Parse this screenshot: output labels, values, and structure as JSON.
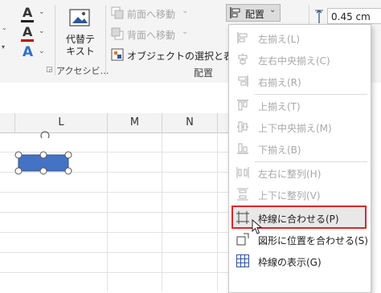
{
  "ribbon": {
    "font_group": {
      "font_color_glyph": "A",
      "highlight_glyph": "A",
      "text_effects_glyph": "A"
    },
    "alt_text_button_label": "代替テ\nキスト",
    "accessibility_group_label": "アクセシビ…",
    "arrange": {
      "bring_forward": "前面へ移動",
      "send_backward": "背面へ移動",
      "selection_pane": "オブジェクトの選択と表示",
      "group_label": "配置",
      "align_button_label": "配置"
    },
    "size": {
      "height_value": "0.45 cm"
    }
  },
  "sheet": {
    "columns": [
      "L",
      "M",
      "N"
    ]
  },
  "align_menu": {
    "items": [
      {
        "label": "左揃え(L)",
        "enabled": false,
        "icon": "align-left-icon"
      },
      {
        "label": "左右中央揃え(C)",
        "enabled": false,
        "icon": "align-center-icon"
      },
      {
        "label": "右揃え(R)",
        "enabled": false,
        "icon": "align-right-icon"
      },
      {
        "label": "上揃え(T)",
        "enabled": false,
        "icon": "align-top-icon"
      },
      {
        "label": "上下中央揃え(M)",
        "enabled": false,
        "icon": "align-middle-icon"
      },
      {
        "label": "下揃え(B)",
        "enabled": false,
        "icon": "align-bottom-icon"
      },
      {
        "label": "左右に整列(H)",
        "enabled": false,
        "icon": "distribute-horizontal-icon"
      },
      {
        "label": "上下に整列(V)",
        "enabled": false,
        "icon": "distribute-vertical-icon"
      },
      {
        "label": "枠線に合わせる(P)",
        "enabled": true,
        "highlighted": true,
        "icon": "snap-to-grid-icon"
      },
      {
        "label": "図形に位置を合わせる(S)",
        "enabled": true,
        "icon": "snap-to-shape-icon"
      },
      {
        "label": "枠線の表示(G)",
        "enabled": true,
        "icon": "view-gridlines-icon"
      }
    ]
  },
  "colors": {
    "ribbon_bg": "#f4f4f4",
    "highlight_border": "#d9262b",
    "shape_fill": "#4472c4",
    "disabled_text": "#a8a8a8",
    "accent_blue": "#2b579a"
  }
}
